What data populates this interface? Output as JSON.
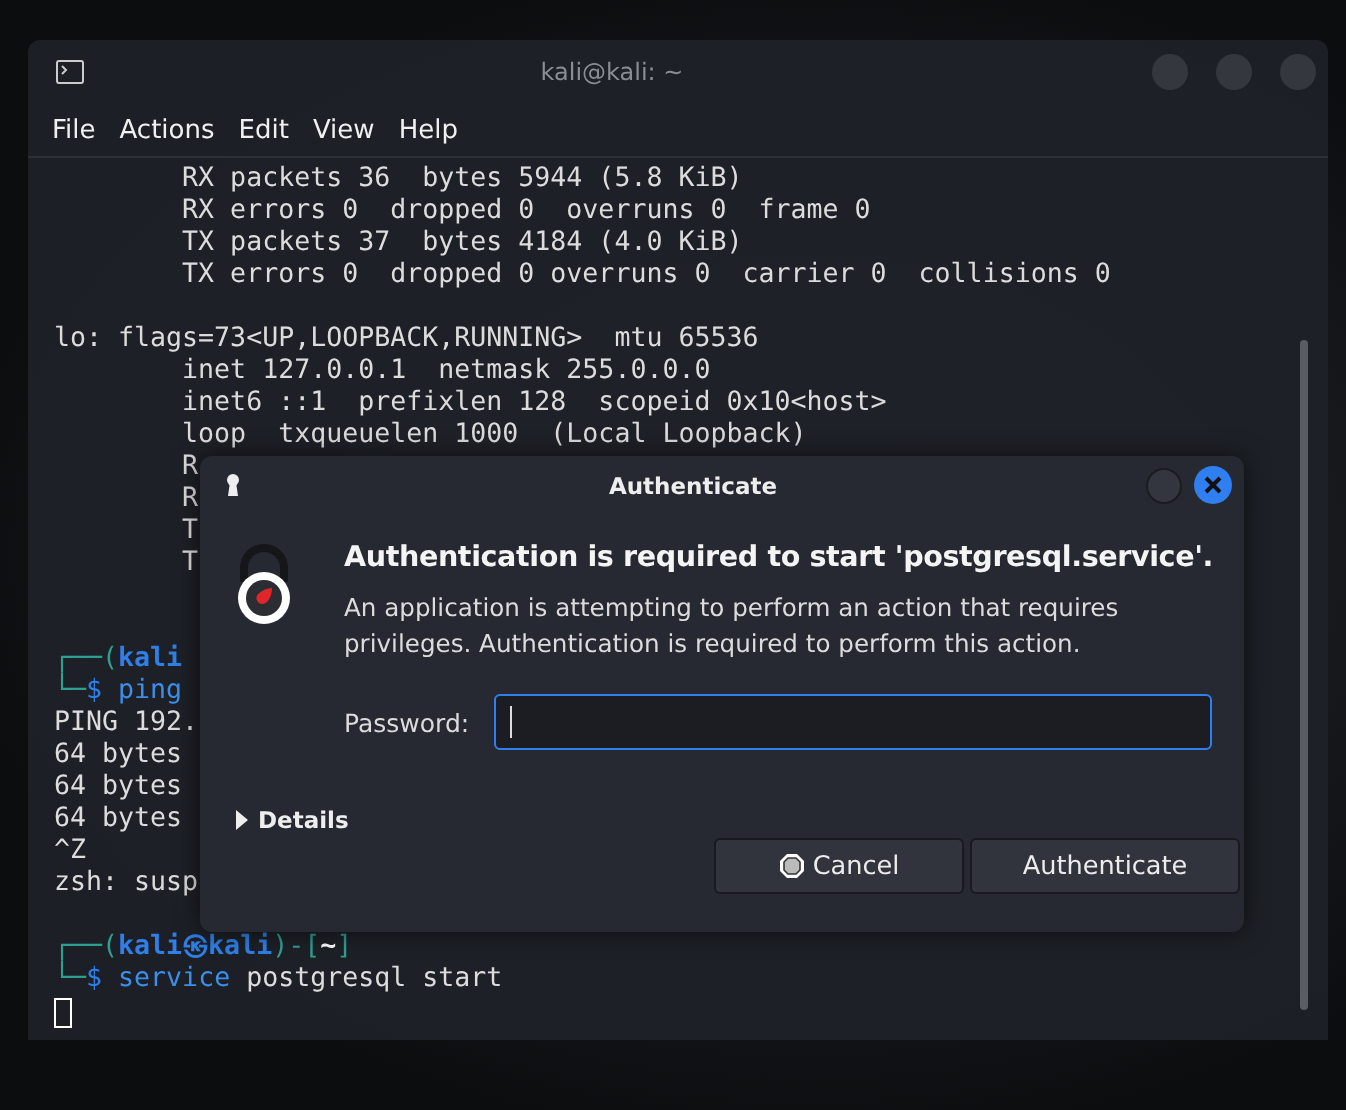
{
  "terminal": {
    "title": "kali@kali: ~",
    "menu": [
      "File",
      "Actions",
      "Edit",
      "View",
      "Help"
    ],
    "lines": [
      {
        "kind": "output",
        "segments": [
          {
            "kind": "plain",
            "text": "        RX packets 36  bytes 5944 (5.8 KiB)"
          }
        ]
      },
      {
        "kind": "output",
        "segments": [
          {
            "kind": "plain",
            "text": "        RX errors 0  dropped 0  overruns 0  frame 0"
          }
        ]
      },
      {
        "kind": "output",
        "segments": [
          {
            "kind": "plain",
            "text": "        TX packets 37  bytes 4184 (4.0 KiB)"
          }
        ]
      },
      {
        "kind": "output",
        "segments": [
          {
            "kind": "plain",
            "text": "        TX errors 0  dropped 0 overruns 0  carrier 0  collisions 0"
          }
        ]
      },
      {
        "kind": "blank"
      },
      {
        "kind": "output",
        "segments": [
          {
            "kind": "plain",
            "text": "lo: flags=73<UP,LOOPBACK,RUNNING>  mtu 65536"
          }
        ]
      },
      {
        "kind": "output",
        "segments": [
          {
            "kind": "plain",
            "text": "        inet 127.0.0.1  netmask 255.0.0.0"
          }
        ]
      },
      {
        "kind": "output",
        "segments": [
          {
            "kind": "plain",
            "text": "        inet6 ::1  prefixlen 128  scopeid 0x10<host>"
          }
        ]
      },
      {
        "kind": "output",
        "segments": [
          {
            "kind": "plain",
            "text": "        loop  txqueuelen 1000  (Local Loopback)"
          }
        ]
      },
      {
        "kind": "output",
        "segments": [
          {
            "kind": "plain",
            "text": "        R"
          }
        ]
      },
      {
        "kind": "output",
        "segments": [
          {
            "kind": "plain",
            "text": "        R"
          }
        ]
      },
      {
        "kind": "output",
        "segments": [
          {
            "kind": "plain",
            "text": "        T"
          }
        ]
      },
      {
        "kind": "output",
        "segments": [
          {
            "kind": "plain",
            "text": "        T"
          }
        ]
      },
      {
        "kind": "blank"
      },
      {
        "kind": "blank"
      },
      {
        "kind": "prompt",
        "segments": [
          {
            "kind": "frame",
            "text": "┌──("
          },
          {
            "kind": "user",
            "text": "kali"
          }
        ]
      },
      {
        "kind": "prompt",
        "segments": [
          {
            "kind": "frame",
            "text": "└─"
          },
          {
            "kind": "dollar",
            "text": "$"
          },
          {
            "kind": "command",
            "text": " ping"
          }
        ]
      },
      {
        "kind": "output",
        "segments": [
          {
            "kind": "plain",
            "text": "PING 192."
          }
        ]
      },
      {
        "kind": "output",
        "segments": [
          {
            "kind": "plain",
            "text": "64 bytes"
          }
        ]
      },
      {
        "kind": "output",
        "segments": [
          {
            "kind": "plain",
            "text": "64 bytes"
          }
        ]
      },
      {
        "kind": "output",
        "segments": [
          {
            "kind": "plain",
            "text": "64 bytes"
          }
        ]
      },
      {
        "kind": "output",
        "segments": [
          {
            "kind": "plain",
            "text": "^Z"
          }
        ]
      },
      {
        "kind": "output",
        "segments": [
          {
            "kind": "plain",
            "text": "zsh: susp"
          }
        ]
      },
      {
        "kind": "blank"
      },
      {
        "kind": "prompt",
        "segments": [
          {
            "kind": "frame",
            "text": "┌──("
          },
          {
            "kind": "user",
            "text": "kali㉿kali"
          },
          {
            "kind": "frame",
            "text": ")-["
          },
          {
            "kind": "path",
            "text": "~"
          },
          {
            "kind": "frame",
            "text": "]"
          }
        ]
      },
      {
        "kind": "prompt",
        "segments": [
          {
            "kind": "frame",
            "text": "└─"
          },
          {
            "kind": "dollar",
            "text": "$"
          },
          {
            "kind": "command",
            "text": " service"
          },
          {
            "kind": "plain",
            "text": " postgresql start"
          }
        ]
      },
      {
        "kind": "cursor"
      }
    ]
  },
  "dialog": {
    "title": "Authenticate",
    "heading": "Authentication is required to start 'postgresql.service'.",
    "message": "An application is attempting to perform an action that requires privileges. Authentication is required to perform this action.",
    "password": {
      "label": "Password:",
      "focused": true
    },
    "details": {
      "label": "Details",
      "expanded": false
    },
    "buttons": [
      {
        "kind": "cancel",
        "label": "Cancel"
      },
      {
        "kind": "default",
        "label": "Authenticate"
      }
    ]
  }
}
